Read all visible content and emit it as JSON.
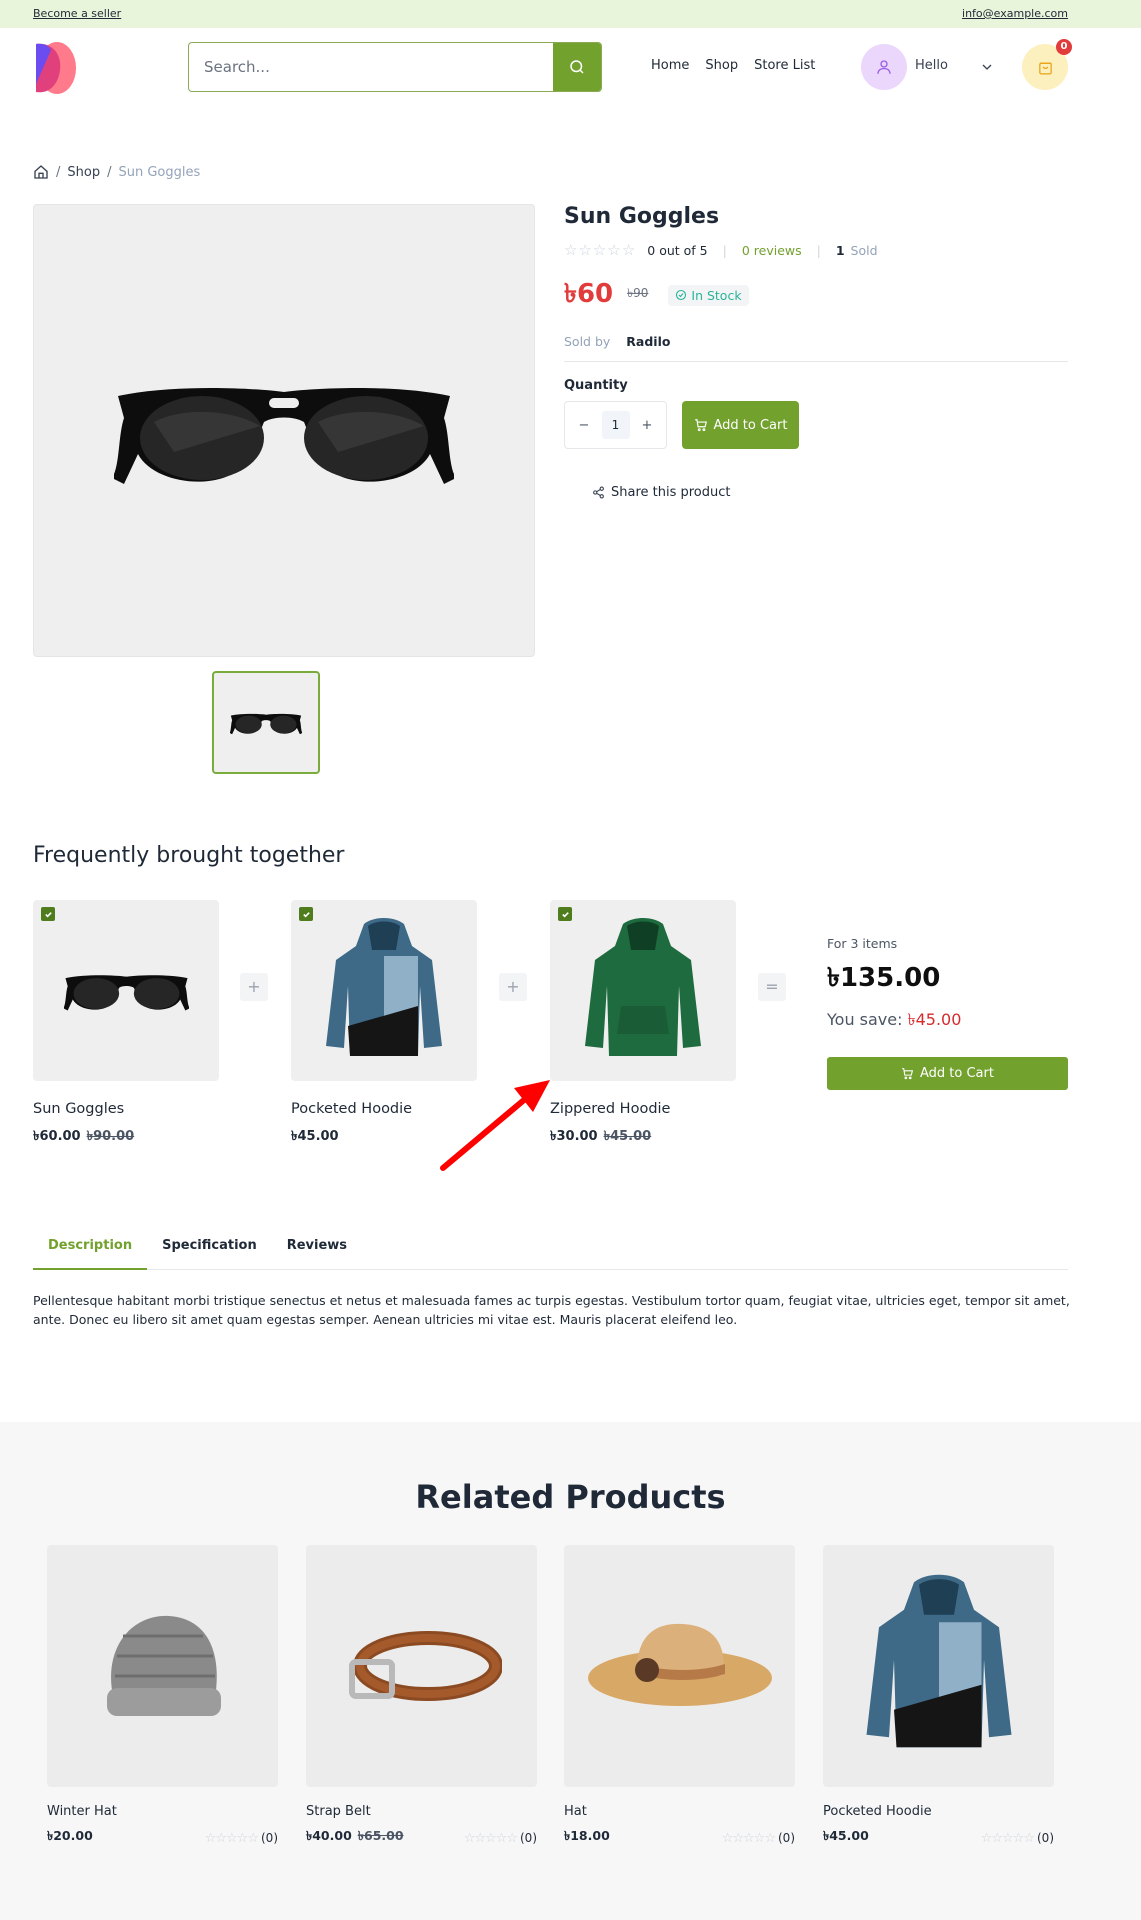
{
  "topbar": {
    "seller_link": "Become a seller",
    "email": "info@example.com"
  },
  "header": {
    "search_placeholder": "Search...",
    "nav": [
      "Home",
      "Shop",
      "Store List"
    ],
    "user_greeting": "Hello",
    "cart_count": "0"
  },
  "breadcrumb": {
    "items": [
      "Shop",
      "Sun Goggles"
    ]
  },
  "product": {
    "title": "Sun Goggles",
    "rating_text": "0 out of 5",
    "rating_value": 0,
    "rating_max": 5,
    "reviews_text": "0 reviews",
    "sold_count": "1",
    "sold_label": "Sold",
    "price": "৳60",
    "old_price": "৳90",
    "stock_status": "In Stock",
    "sold_by_label": "Sold by",
    "seller": "Radilo",
    "quantity_label": "Quantity",
    "quantity_value": "1",
    "add_to_cart": "Add to Cart",
    "share_label": "Share this product"
  },
  "fbt": {
    "title": "Frequently brought together",
    "items": [
      {
        "name": "Sun Goggles",
        "price": "৳60.00",
        "old_price": "৳90.00",
        "checked": true
      },
      {
        "name": "Pocketed Hoodie",
        "price": "৳45.00",
        "old_price": "",
        "checked": true
      },
      {
        "name": "Zippered Hoodie",
        "price": "৳30.00",
        "old_price": "৳45.00",
        "checked": true
      }
    ],
    "plus_symbol": "+",
    "equals_symbol": "=",
    "for_items": "For 3 items",
    "total": "৳135.00",
    "save_label": "You save:",
    "save_value": "৳45.00",
    "add_to_cart": "Add to Cart"
  },
  "tabs": {
    "items": [
      "Description",
      "Specification",
      "Reviews"
    ],
    "active": "Description",
    "description": "Pellentesque habitant morbi tristique senectus et netus et malesuada fames ac turpis egestas. Vestibulum tortor quam, feugiat vitae, ultricies eget, tempor sit amet, ante. Donec eu libero sit amet quam egestas semper. Aenean ultricies mi vitae est. Mauris placerat eleifend leo."
  },
  "related": {
    "title": "Related Products",
    "items": [
      {
        "name": "Winter Hat",
        "price": "৳20.00",
        "old_price": "",
        "review_count": "(0)"
      },
      {
        "name": "Strap Belt",
        "price": "৳40.00",
        "old_price": "৳65.00",
        "review_count": "(0)"
      },
      {
        "name": "Hat",
        "price": "৳18.00",
        "old_price": "",
        "review_count": "(0)"
      },
      {
        "name": "Pocketed Hoodie",
        "price": "৳45.00",
        "old_price": "",
        "review_count": "(0)"
      }
    ]
  },
  "colors": {
    "brand_green": "#72a12e",
    "price_red": "#e23b3b",
    "topbar_bg": "#e9f5da",
    "annotation_arrow": "#ff0000"
  }
}
